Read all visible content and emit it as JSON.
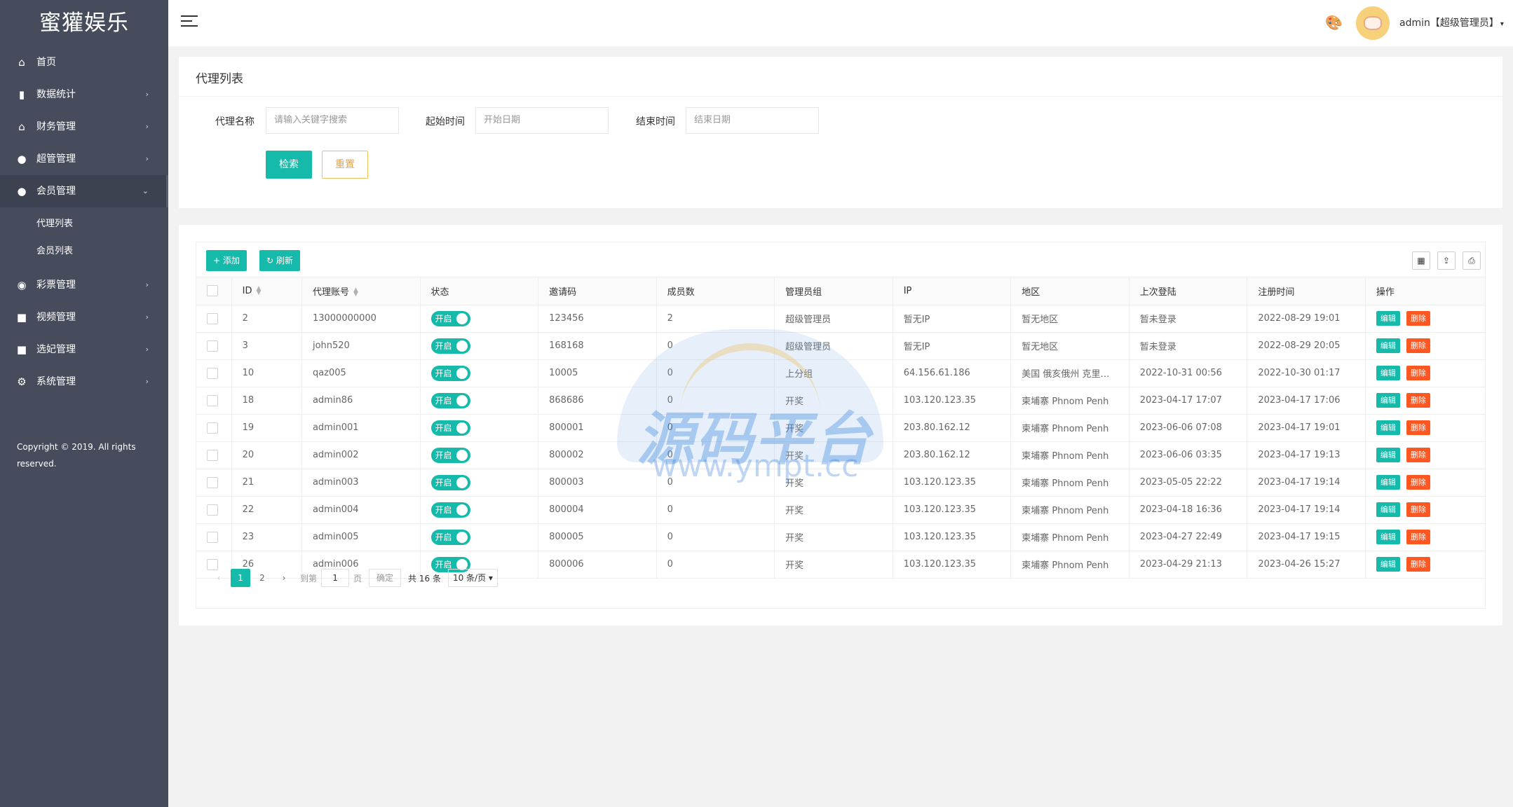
{
  "app": {
    "title": "蜜獾娱乐",
    "copyright": "Copyright © 2019. All rights reserved."
  },
  "sidebar": {
    "items": [
      {
        "label": "首页",
        "icon": "home-icon",
        "glyph": "⌂",
        "arrow": ""
      },
      {
        "label": "数据统计",
        "icon": "bar-chart-icon",
        "glyph": "▮",
        "arrow": "›"
      },
      {
        "label": "财务管理",
        "icon": "bank-icon",
        "glyph": "⌂",
        "arrow": "›"
      },
      {
        "label": "超管管理",
        "icon": "user-icon",
        "glyph": "●",
        "arrow": "›"
      },
      {
        "label": "会员管理",
        "icon": "users-icon",
        "glyph": "●",
        "arrow": "⌄"
      },
      {
        "label": "彩票管理",
        "icon": "gamepad-icon",
        "glyph": "◉",
        "arrow": "›"
      },
      {
        "label": "视频管理",
        "icon": "video-icon",
        "glyph": "■",
        "arrow": "›"
      },
      {
        "label": "选妃管理",
        "icon": "camera-icon",
        "glyph": "■",
        "arrow": "›"
      },
      {
        "label": "系统管理",
        "icon": "gear-icon",
        "glyph": "⚙",
        "arrow": "›"
      }
    ],
    "subitems": [
      "代理列表",
      "会员列表"
    ]
  },
  "header": {
    "user_label": "admin【超级管理员】",
    "caret": "▾",
    "theme_glyph": "🎨"
  },
  "search": {
    "title": "代理列表",
    "name_label": "代理名称",
    "name_placeholder": "请输入关键字搜索",
    "start_label": "起始时间",
    "start_placeholder": "开始日期",
    "end_label": "结束时间",
    "end_placeholder": "结束日期",
    "search_button": "检索",
    "reset_button": "重置"
  },
  "toolbar": {
    "add_label": "+ 添加",
    "refresh_label": "↻ 刷新",
    "tools": [
      {
        "name": "columns-icon",
        "glyph": "▦"
      },
      {
        "name": "export-icon",
        "glyph": "⇪"
      },
      {
        "name": "print-icon",
        "glyph": "⎙"
      }
    ]
  },
  "table": {
    "columns": [
      "ID",
      "代理账号",
      "状态",
      "邀请码",
      "成员数",
      "管理员组",
      "IP",
      "地区",
      "上次登陆",
      "注册时间",
      "操作"
    ],
    "status_label": "开启",
    "edit_label": "编辑",
    "delete_label": "删除",
    "rows": [
      {
        "id": "2",
        "account": "13000000000",
        "invite": "123456",
        "members": "2",
        "group": "超级管理员",
        "ip": "暂无IP",
        "region": "暂无地区",
        "last_login": "暂未登录",
        "registered": "2022-08-29 19:01"
      },
      {
        "id": "3",
        "account": "john520",
        "invite": "168168",
        "members": "0",
        "group": "超级管理员",
        "ip": "暂无IP",
        "region": "暂无地区",
        "last_login": "暂未登录",
        "registered": "2022-08-29 20:05"
      },
      {
        "id": "10",
        "account": "qaz005",
        "invite": "10005",
        "members": "0",
        "group": "上分组",
        "ip": "64.156.61.186",
        "region": "美国 俄亥俄州 克里夫兰",
        "last_login": "2022-10-31 00:56",
        "registered": "2022-10-30 01:17"
      },
      {
        "id": "18",
        "account": "admin86",
        "invite": "868686",
        "members": "0",
        "group": "开奖",
        "ip": "103.120.123.35",
        "region": "柬埔寨 Phnom Penh",
        "last_login": "2023-04-17 17:07",
        "registered": "2023-04-17 17:06"
      },
      {
        "id": "19",
        "account": "admin001",
        "invite": "800001",
        "members": "0",
        "group": "开奖",
        "ip": "203.80.162.12",
        "region": "柬埔寨 Phnom Penh",
        "last_login": "2023-06-06 07:08",
        "registered": "2023-04-17 19:01"
      },
      {
        "id": "20",
        "account": "admin002",
        "invite": "800002",
        "members": "0",
        "group": "开奖",
        "ip": "203.80.162.12",
        "region": "柬埔寨 Phnom Penh",
        "last_login": "2023-06-06 03:35",
        "registered": "2023-04-17 19:13"
      },
      {
        "id": "21",
        "account": "admin003",
        "invite": "800003",
        "members": "0",
        "group": "开奖",
        "ip": "103.120.123.35",
        "region": "柬埔寨 Phnom Penh",
        "last_login": "2023-05-05 22:22",
        "registered": "2023-04-17 19:14"
      },
      {
        "id": "22",
        "account": "admin004",
        "invite": "800004",
        "members": "0",
        "group": "开奖",
        "ip": "103.120.123.35",
        "region": "柬埔寨 Phnom Penh",
        "last_login": "2023-04-18 16:36",
        "registered": "2023-04-17 19:14"
      },
      {
        "id": "23",
        "account": "admin005",
        "invite": "800005",
        "members": "0",
        "group": "开奖",
        "ip": "103.120.123.35",
        "region": "柬埔寨 Phnom Penh",
        "last_login": "2023-04-27 22:49",
        "registered": "2023-04-17 19:15"
      },
      {
        "id": "26",
        "account": "admin006",
        "invite": "800006",
        "members": "0",
        "group": "开奖",
        "ip": "103.120.123.35",
        "region": "柬埔寨 Phnom Penh",
        "last_login": "2023-04-29 21:13",
        "registered": "2023-04-26 15:27"
      }
    ]
  },
  "pager": {
    "prev": "‹",
    "pages": [
      "1",
      "2"
    ],
    "current": "1",
    "next": "›",
    "goto_label": "到第",
    "goto_value": "1",
    "page_unit": "页",
    "confirm": "确定",
    "total": "共 16 条",
    "per_page": "10 条/页 ▾"
  },
  "watermark": {
    "text": "源码平台",
    "url": "www.ympt.cc"
  }
}
